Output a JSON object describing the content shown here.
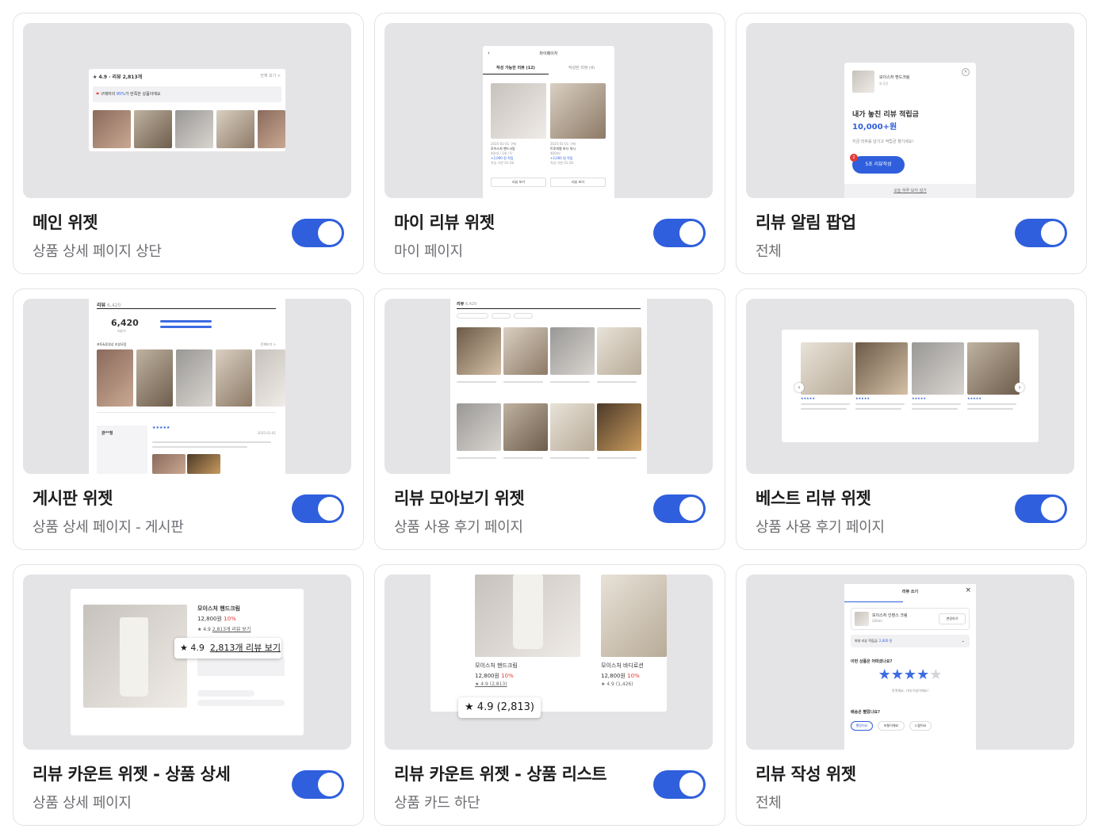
{
  "cards": [
    {
      "title": "메인 위젯",
      "subtitle": "상품 상세 페이지 상단",
      "enabled": true,
      "preview": {
        "rating": "★ 4.9 · 리뷰 2,813개",
        "more": "전체 보기 >",
        "banner_prefix": "구매자의 ",
        "banner_pct": "95%",
        "banner_suffix": "가 만족한 상품이에요"
      }
    },
    {
      "title": "마이 리뷰 위젯",
      "subtitle": "마이 페이지",
      "enabled": true,
      "preview": {
        "header": "마이페이지",
        "tab_writable": "작성 가능한 리뷰 (12)",
        "tab_written": "작성한 리뷰 (4)",
        "items": [
          {
            "date": "2025-01-01 구매",
            "name": "모이스처 핸드크림",
            "option": "40ml / 1개 / Fr",
            "reward": "+2,000 원 적립",
            "deadline": "작성 기한 01-28",
            "button": "리뷰 보기"
          },
          {
            "date": "2025-01-01 구매",
            "name": "트로피컬 바디 워시",
            "option": "400ml",
            "reward": "+2,000 원 적립",
            "deadline": "작성 기한 01-28",
            "button": "리뷰 보기"
          }
        ]
      }
    },
    {
      "title": "리뷰 알림 팝업",
      "subtitle": "전체",
      "enabled": true,
      "preview": {
        "product": "모이스처 핸드크림",
        "product_sub": "외 2건",
        "headline": "내가 놓친 리뷰 적립금",
        "amount": "10,000+원",
        "desc": "지금 리뷰를 남기고 적립금 챙기세요!",
        "badge": "2",
        "button": "5초 리뷰작성",
        "footer": "오늘 하루 보지 않기"
      }
    },
    {
      "title": "게시판 위젯",
      "subtitle": "상품 상세 페이지 - 게시판",
      "enabled": true,
      "preview": {
        "header": "리뷰",
        "count": "6,420",
        "big": "6,420",
        "big_label": "리뷰수",
        "photo_label": "포토&동영상 리뷰모음",
        "more": "전체보기 >",
        "reviewer": "관**정",
        "date": "2025-01-01"
      }
    },
    {
      "title": "리뷰 모아보기 위젯",
      "subtitle": "상품 사용 후기 페이지",
      "enabled": true,
      "preview": {
        "header": "리뷰",
        "count": "6,420"
      }
    },
    {
      "title": "베스트 리뷰 위젯",
      "subtitle": "상품 사용 후기 페이지",
      "enabled": true,
      "preview": {}
    },
    {
      "title": "리뷰 카운트 위젯 - 상품 상세",
      "subtitle": "상품 상세 페이지",
      "enabled": true,
      "preview": {
        "name": "모이스처 핸드크림",
        "price": "12,800원",
        "discount": "10%",
        "rating_small": "★ 4.9",
        "count_small": "2,813개 리뷰 보기",
        "rating_big": "★ 4.9",
        "count_big": "2,813개 리뷰 보기"
      }
    },
    {
      "title": "리뷰 카운트 위젯 - 상품 리스트",
      "subtitle": "상품 카드 하단",
      "enabled": true,
      "preview": {
        "p1_name": "모이스처 핸드크림",
        "p1_price": "12,800원",
        "p1_discount": "10%",
        "p1_rating": "★ 4.9 (2,813)",
        "p2_name": "모이스처 바디로션",
        "p2_price": "12,800원",
        "p2_discount": "10%",
        "p2_rating": "★ 4.9 (1,426)",
        "callout": "★ 4.9 (2,813)"
      }
    },
    {
      "title": "리뷰 작성 위젯",
      "subtitle": "전체",
      "enabled": null,
      "preview": {
        "header": "리뷰 쓰기",
        "product": "모이스처 인텐스 크림",
        "product_sub": "200ml",
        "change": "변경하기",
        "reward_label": "최대 리뷰 적립금: ",
        "reward_value": "2,000 원",
        "q1": "이번 상품은 어떠셨나요?",
        "stars": "★★★★",
        "star_off": "★",
        "hint": "만족해요. 기대 이상이에요!",
        "q2": "배송은 빨랐나요?",
        "opt1": "빨랐어요",
        "opt2": "보통이에요",
        "opt3": "느렸어요"
      }
    }
  ],
  "colors": {
    "toggle_on": "#2f5fdc",
    "thumb_bg": "#e4e4e7",
    "accent_red": "#e53935"
  }
}
